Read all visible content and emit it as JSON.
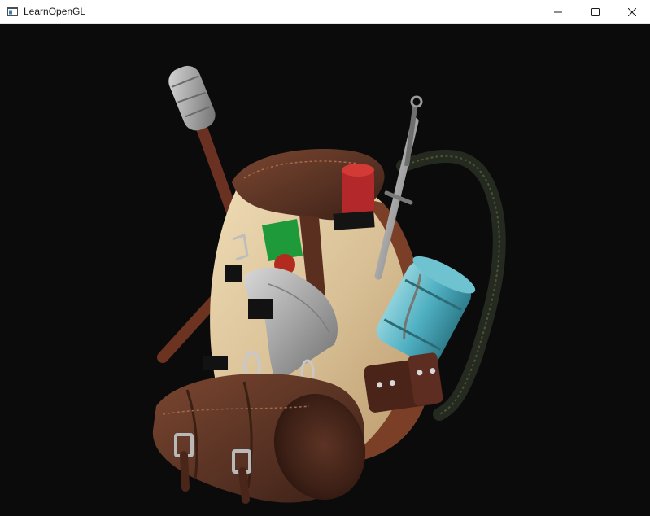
{
  "window": {
    "title": "LearnOpenGL",
    "controls": {
      "minimize_icon": "minimize-icon",
      "maximize_icon": "maximize-icon",
      "close_icon": "close-icon"
    }
  },
  "viewport": {
    "background": "#0b0b0c",
    "content": "3d-backpack-model"
  },
  "colors": {
    "leather": "#5a2f1f",
    "leather_dark": "#3b1e13",
    "wood": "#d9c29a",
    "metal": "#9a9a9a",
    "bottle": "#5fb6c6",
    "strap": "#2b2f25"
  }
}
